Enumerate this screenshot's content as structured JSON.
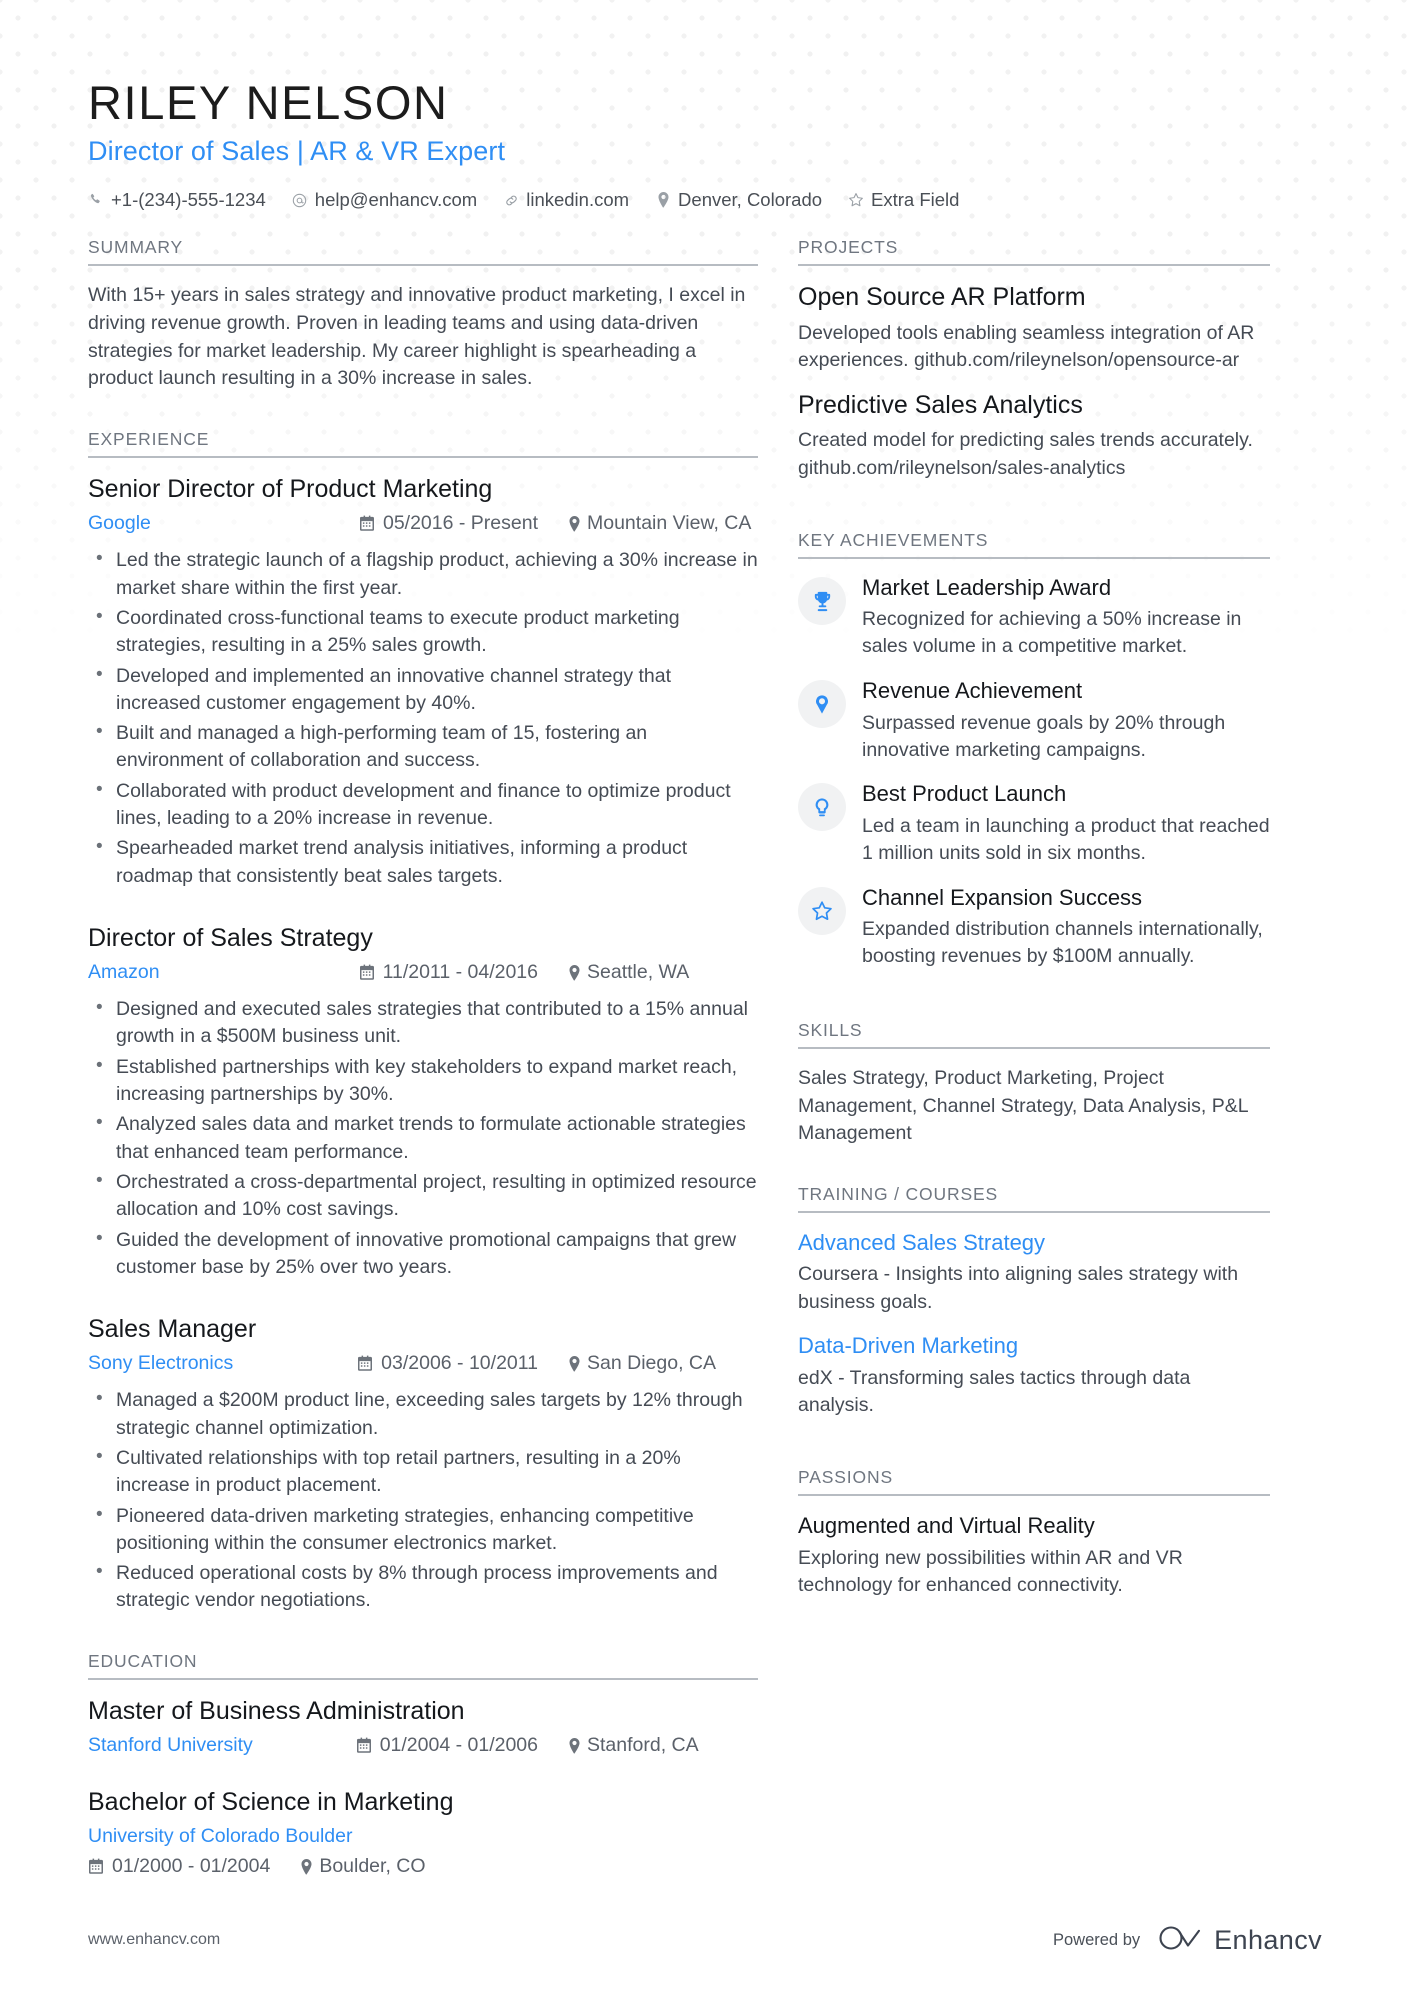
{
  "header": {
    "name": "RILEY NELSON",
    "role": "Director of Sales | AR & VR Expert",
    "contacts": [
      {
        "icon": "phone-icon",
        "text": "+1-(234)-555-1234"
      },
      {
        "icon": "email-icon",
        "text": "help@enhancv.com"
      },
      {
        "icon": "link-icon",
        "text": "linkedin.com"
      },
      {
        "icon": "location-pin-icon",
        "text": "Denver, Colorado"
      },
      {
        "icon": "star-icon",
        "text": "Extra Field"
      }
    ]
  },
  "sections": {
    "summary_title": "SUMMARY",
    "experience_title": "EXPERIENCE",
    "education_title": "EDUCATION",
    "projects_title": "PROJECTS",
    "achievements_title": "KEY ACHIEVEMENTS",
    "skills_title": "SKILLS",
    "training_title": "TRAINING / COURSES",
    "passions_title": "PASSIONS"
  },
  "summary": {
    "text": "With 15+ years in sales strategy and innovative product marketing, I excel in driving revenue growth. Proven in leading teams and using data-driven strategies for market leadership. My career highlight is spearheading a product launch resulting in a 30% increase in sales."
  },
  "experience": [
    {
      "title": "Senior Director of Product Marketing",
      "company": "Google",
      "date": "05/2016 - Present",
      "location": "Mountain View, CA",
      "bullets": [
        "Led the strategic launch of a flagship product, achieving a 30% increase in market share within the first year.",
        "Coordinated cross-functional teams to execute product marketing strategies, resulting in a 25% sales growth.",
        "Developed and implemented an innovative channel strategy that increased customer engagement by 40%.",
        "Built and managed a high-performing team of 15, fostering an environment of collaboration and success.",
        "Collaborated with product development and finance to optimize product lines, leading to a 20% increase in revenue.",
        "Spearheaded market trend analysis initiatives, informing a product roadmap that consistently beat sales targets."
      ]
    },
    {
      "title": "Director of Sales Strategy",
      "company": "Amazon",
      "date": "11/2011 - 04/2016",
      "location": "Seattle, WA",
      "bullets": [
        "Designed and executed sales strategies that contributed to a 15% annual growth in a $500M business unit.",
        "Established partnerships with key stakeholders to expand market reach, increasing partnerships by 30%.",
        "Analyzed sales data and market trends to formulate actionable strategies that enhanced team performance.",
        "Orchestrated a cross-departmental project, resulting in optimized resource allocation and 10% cost savings.",
        "Guided the development of innovative promotional campaigns that grew customer base by 25% over two years."
      ]
    },
    {
      "title": "Sales Manager",
      "company": "Sony Electronics",
      "date": "03/2006 - 10/2011",
      "location": "San Diego, CA",
      "bullets": [
        "Managed a $200M product line, exceeding sales targets by 12% through strategic channel optimization.",
        "Cultivated relationships with top retail partners, resulting in a 20% increase in product placement.",
        "Pioneered data-driven marketing strategies, enhancing competitive positioning within the consumer electronics market.",
        "Reduced operational costs by 8% through process improvements and strategic vendor negotiations."
      ]
    }
  ],
  "education": [
    {
      "degree": "Master of Business Administration",
      "school": "Stanford University",
      "date": "01/2004 - 01/2006",
      "location": "Stanford, CA",
      "layout": "inline"
    },
    {
      "degree": "Bachelor of Science in Marketing",
      "school": "University of Colorado Boulder",
      "date": "01/2000 - 01/2004",
      "location": "Boulder, CO",
      "layout": "stacked"
    }
  ],
  "projects": [
    {
      "title": "Open Source AR Platform",
      "description": "Developed tools enabling seamless integration of AR experiences. github.com/rileynelson/opensource-ar"
    },
    {
      "title": "Predictive Sales Analytics",
      "description": "Created model for predicting sales trends accurately. github.com/rileynelson/sales-analytics"
    }
  ],
  "achievements": [
    {
      "icon": "trophy-icon",
      "title": "Market Leadership Award",
      "description": "Recognized for achieving a 50% increase in sales volume in a competitive market."
    },
    {
      "icon": "medal-icon",
      "title": "Revenue Achievement",
      "description": "Surpassed revenue goals by 20% through innovative marketing campaigns."
    },
    {
      "icon": "lightbulb-icon",
      "title": "Best Product Launch",
      "description": "Led a team in launching a product that reached 1 million units sold in six months."
    },
    {
      "icon": "star-outline-icon",
      "title": "Channel Expansion Success",
      "description": "Expanded distribution channels internationally, boosting revenues by $100M annually."
    }
  ],
  "skills": {
    "text": "Sales Strategy, Product Marketing, Project Management, Channel Strategy, Data Analysis, P&L Management"
  },
  "training": [
    {
      "title": "Advanced Sales Strategy",
      "description": "Coursera - Insights into aligning sales strategy with business goals."
    },
    {
      "title": "Data-Driven Marketing",
      "description": "edX - Transforming sales tactics through data analysis."
    }
  ],
  "passions": [
    {
      "title": "Augmented and Virtual Reality",
      "description": "Exploring new possibilities within AR and VR technology for enhanced connectivity."
    }
  ],
  "footer": {
    "url": "www.enhancv.com",
    "powered_by": "Powered by",
    "brand": "Enhancv"
  },
  "colors": {
    "accent": "#2f8ef4",
    "text": "#454b54",
    "heading": "#15181c",
    "muted": "#6f7680"
  }
}
